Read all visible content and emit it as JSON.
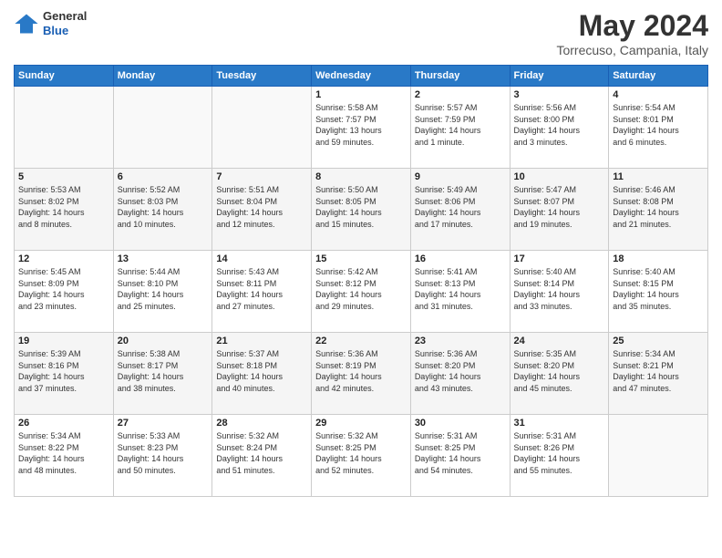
{
  "header": {
    "logo_general": "General",
    "logo_blue": "Blue",
    "month": "May 2024",
    "location": "Torrecuso, Campania, Italy"
  },
  "weekdays": [
    "Sunday",
    "Monday",
    "Tuesday",
    "Wednesday",
    "Thursday",
    "Friday",
    "Saturday"
  ],
  "weeks": [
    [
      {
        "day": "",
        "text": ""
      },
      {
        "day": "",
        "text": ""
      },
      {
        "day": "",
        "text": ""
      },
      {
        "day": "1",
        "text": "Sunrise: 5:58 AM\nSunset: 7:57 PM\nDaylight: 13 hours\nand 59 minutes."
      },
      {
        "day": "2",
        "text": "Sunrise: 5:57 AM\nSunset: 7:59 PM\nDaylight: 14 hours\nand 1 minute."
      },
      {
        "day": "3",
        "text": "Sunrise: 5:56 AM\nSunset: 8:00 PM\nDaylight: 14 hours\nand 3 minutes."
      },
      {
        "day": "4",
        "text": "Sunrise: 5:54 AM\nSunset: 8:01 PM\nDaylight: 14 hours\nand 6 minutes."
      }
    ],
    [
      {
        "day": "5",
        "text": "Sunrise: 5:53 AM\nSunset: 8:02 PM\nDaylight: 14 hours\nand 8 minutes."
      },
      {
        "day": "6",
        "text": "Sunrise: 5:52 AM\nSunset: 8:03 PM\nDaylight: 14 hours\nand 10 minutes."
      },
      {
        "day": "7",
        "text": "Sunrise: 5:51 AM\nSunset: 8:04 PM\nDaylight: 14 hours\nand 12 minutes."
      },
      {
        "day": "8",
        "text": "Sunrise: 5:50 AM\nSunset: 8:05 PM\nDaylight: 14 hours\nand 15 minutes."
      },
      {
        "day": "9",
        "text": "Sunrise: 5:49 AM\nSunset: 8:06 PM\nDaylight: 14 hours\nand 17 minutes."
      },
      {
        "day": "10",
        "text": "Sunrise: 5:47 AM\nSunset: 8:07 PM\nDaylight: 14 hours\nand 19 minutes."
      },
      {
        "day": "11",
        "text": "Sunrise: 5:46 AM\nSunset: 8:08 PM\nDaylight: 14 hours\nand 21 minutes."
      }
    ],
    [
      {
        "day": "12",
        "text": "Sunrise: 5:45 AM\nSunset: 8:09 PM\nDaylight: 14 hours\nand 23 minutes."
      },
      {
        "day": "13",
        "text": "Sunrise: 5:44 AM\nSunset: 8:10 PM\nDaylight: 14 hours\nand 25 minutes."
      },
      {
        "day": "14",
        "text": "Sunrise: 5:43 AM\nSunset: 8:11 PM\nDaylight: 14 hours\nand 27 minutes."
      },
      {
        "day": "15",
        "text": "Sunrise: 5:42 AM\nSunset: 8:12 PM\nDaylight: 14 hours\nand 29 minutes."
      },
      {
        "day": "16",
        "text": "Sunrise: 5:41 AM\nSunset: 8:13 PM\nDaylight: 14 hours\nand 31 minutes."
      },
      {
        "day": "17",
        "text": "Sunrise: 5:40 AM\nSunset: 8:14 PM\nDaylight: 14 hours\nand 33 minutes."
      },
      {
        "day": "18",
        "text": "Sunrise: 5:40 AM\nSunset: 8:15 PM\nDaylight: 14 hours\nand 35 minutes."
      }
    ],
    [
      {
        "day": "19",
        "text": "Sunrise: 5:39 AM\nSunset: 8:16 PM\nDaylight: 14 hours\nand 37 minutes."
      },
      {
        "day": "20",
        "text": "Sunrise: 5:38 AM\nSunset: 8:17 PM\nDaylight: 14 hours\nand 38 minutes."
      },
      {
        "day": "21",
        "text": "Sunrise: 5:37 AM\nSunset: 8:18 PM\nDaylight: 14 hours\nand 40 minutes."
      },
      {
        "day": "22",
        "text": "Sunrise: 5:36 AM\nSunset: 8:19 PM\nDaylight: 14 hours\nand 42 minutes."
      },
      {
        "day": "23",
        "text": "Sunrise: 5:36 AM\nSunset: 8:20 PM\nDaylight: 14 hours\nand 43 minutes."
      },
      {
        "day": "24",
        "text": "Sunrise: 5:35 AM\nSunset: 8:20 PM\nDaylight: 14 hours\nand 45 minutes."
      },
      {
        "day": "25",
        "text": "Sunrise: 5:34 AM\nSunset: 8:21 PM\nDaylight: 14 hours\nand 47 minutes."
      }
    ],
    [
      {
        "day": "26",
        "text": "Sunrise: 5:34 AM\nSunset: 8:22 PM\nDaylight: 14 hours\nand 48 minutes."
      },
      {
        "day": "27",
        "text": "Sunrise: 5:33 AM\nSunset: 8:23 PM\nDaylight: 14 hours\nand 50 minutes."
      },
      {
        "day": "28",
        "text": "Sunrise: 5:32 AM\nSunset: 8:24 PM\nDaylight: 14 hours\nand 51 minutes."
      },
      {
        "day": "29",
        "text": "Sunrise: 5:32 AM\nSunset: 8:25 PM\nDaylight: 14 hours\nand 52 minutes."
      },
      {
        "day": "30",
        "text": "Sunrise: 5:31 AM\nSunset: 8:25 PM\nDaylight: 14 hours\nand 54 minutes."
      },
      {
        "day": "31",
        "text": "Sunrise: 5:31 AM\nSunset: 8:26 PM\nDaylight: 14 hours\nand 55 minutes."
      },
      {
        "day": "",
        "text": ""
      }
    ]
  ]
}
